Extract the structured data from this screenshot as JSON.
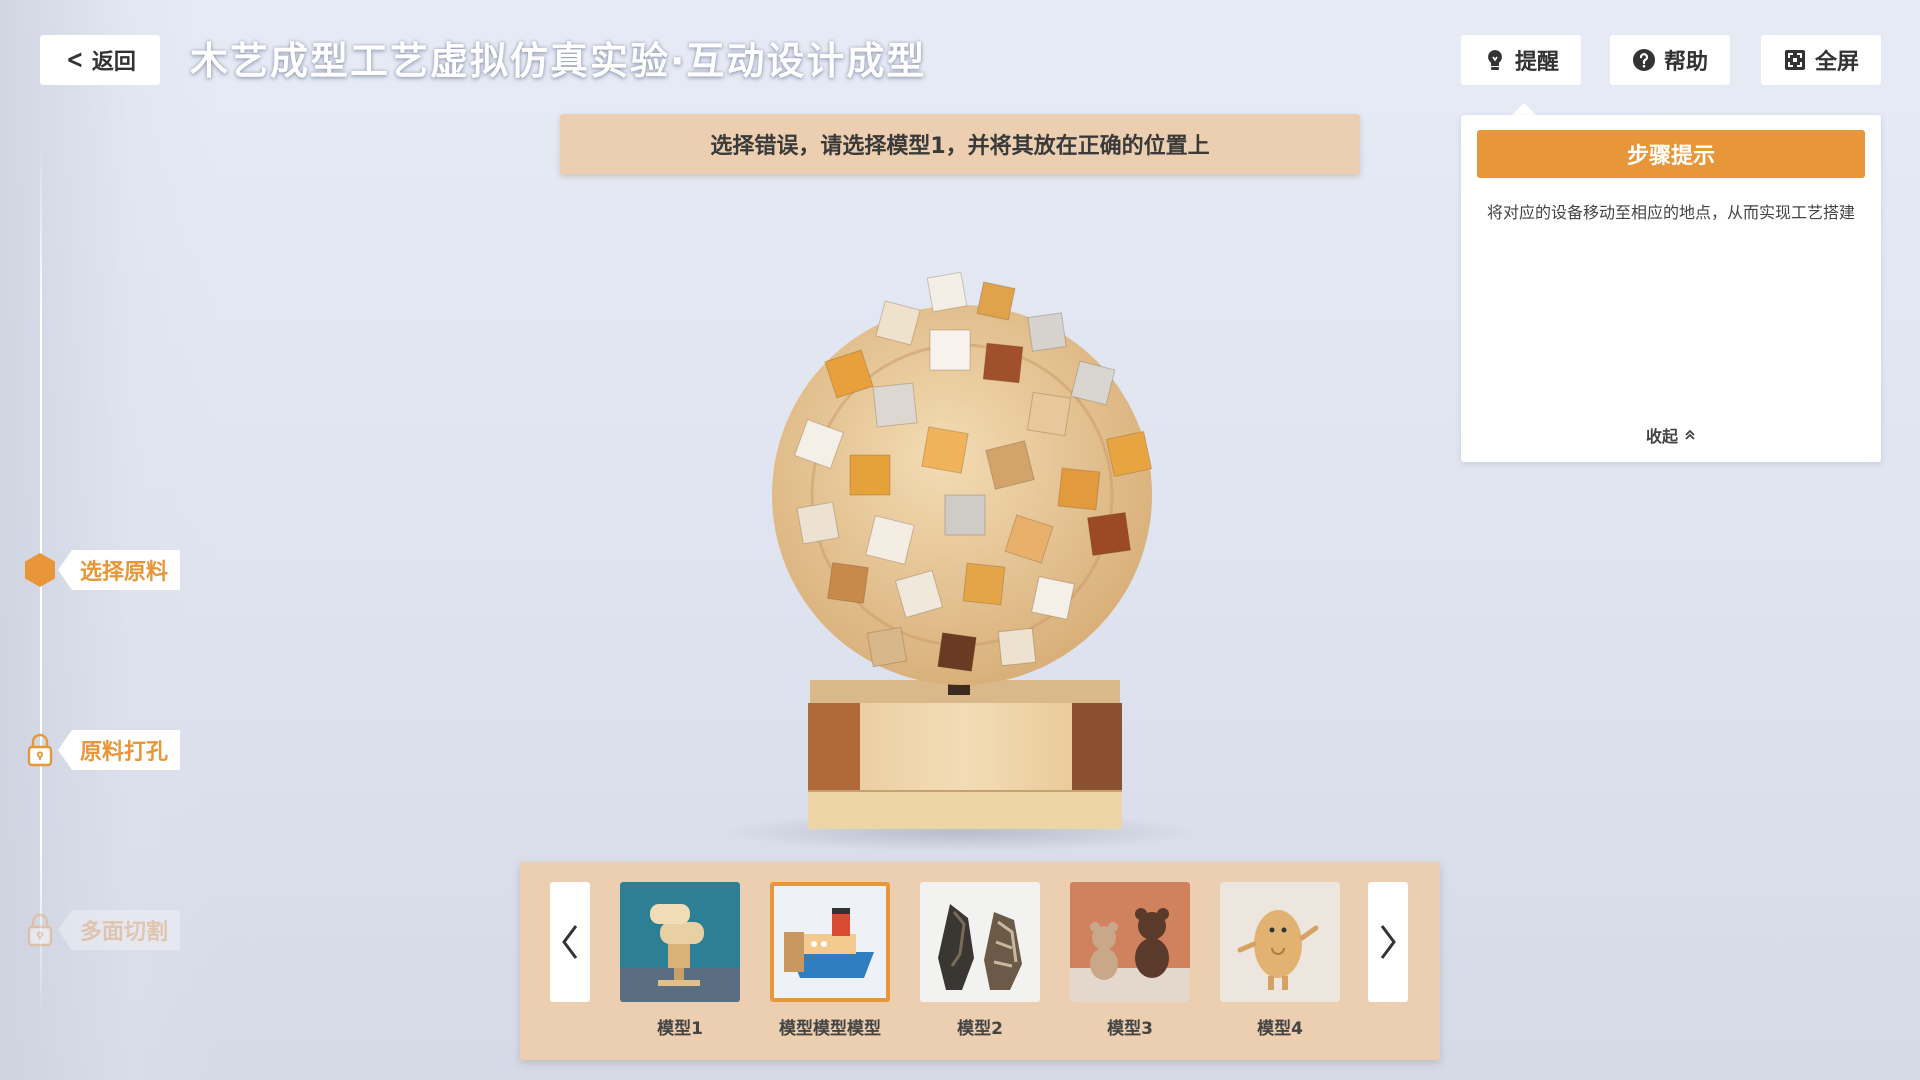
{
  "header": {
    "back_label": "返回",
    "title": "木艺成型工艺虚拟仿真实验·互动设计成型",
    "remind_label": "提醒",
    "help_label": "帮助",
    "fullscreen_label": "全屏"
  },
  "hint_banner": "选择错误，请选择模型1，并将其放在正确的位置上",
  "tip_panel": {
    "title": "步骤提示",
    "text": "将对应的设备移动至相应的地点，从而实现工艺搭建",
    "collapse_label": "收起"
  },
  "steps": [
    {
      "label": "选择原料",
      "state": "active",
      "icon": "hexagon-icon"
    },
    {
      "label": "原料打孔",
      "state": "locked",
      "icon": "lock-icon"
    },
    {
      "label": "多面切割",
      "state": "locked-disabled",
      "icon": "lock-icon"
    }
  ],
  "models": [
    {
      "label": "模型1",
      "selected": false
    },
    {
      "label": "模型模型模型",
      "selected": true
    },
    {
      "label": "模型2",
      "selected": false
    },
    {
      "label": "模型3",
      "selected": false
    },
    {
      "label": "模型4",
      "selected": false
    }
  ],
  "colors": {
    "accent": "#e8963a",
    "banner": "#ebcfb0",
    "background": "#e3e7f1"
  }
}
